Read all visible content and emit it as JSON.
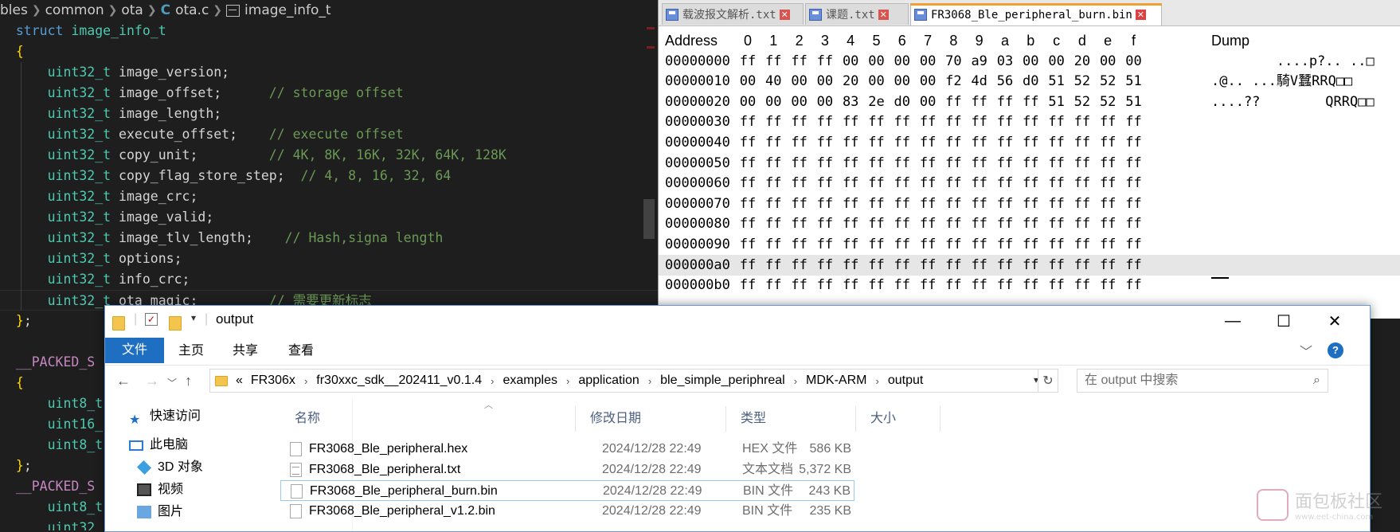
{
  "editor": {
    "breadcrumb": [
      "bles",
      "common",
      "ota",
      "ota.c",
      "image_info_t"
    ],
    "lines": [
      [
        [
          "kw",
          "struct "
        ],
        [
          "ty",
          "image_info_t"
        ]
      ],
      [
        [
          "br",
          "{"
        ]
      ],
      [
        [
          "id",
          "    "
        ],
        [
          "ty",
          "uint32_t"
        ],
        [
          "id",
          " image_version;"
        ]
      ],
      [
        [
          "id",
          "    "
        ],
        [
          "ty",
          "uint32_t"
        ],
        [
          "id",
          " image_offset;      "
        ],
        [
          "cm",
          "// storage offset"
        ]
      ],
      [
        [
          "id",
          "    "
        ],
        [
          "ty",
          "uint32_t"
        ],
        [
          "id",
          " image_length;"
        ]
      ],
      [
        [
          "id",
          "    "
        ],
        [
          "ty",
          "uint32_t"
        ],
        [
          "id",
          " execute_offset;    "
        ],
        [
          "cm",
          "// execute offset"
        ]
      ],
      [
        [
          "id",
          "    "
        ],
        [
          "ty",
          "uint32_t"
        ],
        [
          "id",
          " copy_unit;         "
        ],
        [
          "cm",
          "// 4K, 8K, 16K, 32K, 64K, 128K"
        ]
      ],
      [
        [
          "id",
          "    "
        ],
        [
          "ty",
          "uint32_t"
        ],
        [
          "id",
          " copy_flag_store_step;  "
        ],
        [
          "cm",
          "// 4, 8, 16, 32, 64"
        ]
      ],
      [
        [
          "id",
          "    "
        ],
        [
          "ty",
          "uint32_t"
        ],
        [
          "id",
          " image_crc;"
        ]
      ],
      [
        [
          "id",
          "    "
        ],
        [
          "ty",
          "uint32_t"
        ],
        [
          "id",
          " image_valid;"
        ]
      ],
      [
        [
          "id",
          "    "
        ],
        [
          "ty",
          "uint32_t"
        ],
        [
          "id",
          " image_tlv_length;    "
        ],
        [
          "cm",
          "// Hash,signa length"
        ]
      ],
      [
        [
          "id",
          "    "
        ],
        [
          "ty",
          "uint32_t"
        ],
        [
          "id",
          " options;"
        ]
      ],
      [
        [
          "id",
          "    "
        ],
        [
          "ty",
          "uint32_t"
        ],
        [
          "id",
          " info_crc;"
        ]
      ],
      [
        [
          "id",
          "    "
        ],
        [
          "ty",
          "uint32_t"
        ],
        [
          "id",
          " ota_magic;         "
        ],
        [
          "cm",
          "// 需要更新标志"
        ]
      ],
      [
        [
          "br",
          "}"
        ],
        [
          "id",
          ";"
        ]
      ],
      [
        [
          "id",
          ""
        ]
      ],
      [
        [
          "mc",
          "__PACKED_S"
        ]
      ],
      [
        [
          "br",
          "{"
        ]
      ],
      [
        [
          "id",
          "    "
        ],
        [
          "ty",
          "uint8_t"
        ]
      ],
      [
        [
          "id",
          "    "
        ],
        [
          "ty",
          "uint16_"
        ]
      ],
      [
        [
          "id",
          "    "
        ],
        [
          "ty",
          "uint8_t"
        ]
      ],
      [
        [
          "br",
          "}"
        ],
        [
          "id",
          ";"
        ]
      ],
      [
        [
          "mc",
          "__PACKED_S"
        ]
      ],
      [
        [
          "id",
          "    "
        ],
        [
          "ty",
          "uint8_t"
        ]
      ],
      [
        [
          "id",
          "    "
        ],
        [
          "ty",
          "uint32_"
        ]
      ]
    ]
  },
  "hex": {
    "tabs": [
      {
        "label": "载波报文解析.txt",
        "active": false
      },
      {
        "label": "课题.txt",
        "active": false
      },
      {
        "label": "FR3068_Ble_peripheral_burn.bin",
        "active": true
      }
    ],
    "header": {
      "address": "Address",
      "cols": [
        "0",
        "1",
        "2",
        "3",
        "4",
        "5",
        "6",
        "7",
        "8",
        "9",
        "a",
        "b",
        "c",
        "d",
        "e",
        "f"
      ],
      "dump": "Dump"
    },
    "rows": [
      {
        "addr": "00000000",
        "bytes": [
          "ff",
          "ff",
          "ff",
          "ff",
          "00",
          "00",
          "00",
          "00",
          "70",
          "a9",
          "03",
          "00",
          "00",
          "20",
          "00",
          "00"
        ],
        "dump": "        ....p?.. ..□"
      },
      {
        "addr": "00000010",
        "bytes": [
          "00",
          "40",
          "00",
          "00",
          "20",
          "00",
          "00",
          "00",
          "f2",
          "4d",
          "56",
          "d0",
          "51",
          "52",
          "52",
          "51"
        ],
        "dump": ".@.. ...騎V蠶RRQ□□"
      },
      {
        "addr": "00000020",
        "bytes": [
          "00",
          "00",
          "00",
          "00",
          "83",
          "2e",
          "d0",
          "00",
          "ff",
          "ff",
          "ff",
          "ff",
          "51",
          "52",
          "52",
          "51"
        ],
        "dump": "....??        QRRQ□□"
      },
      {
        "addr": "00000030",
        "bytes": [
          "ff",
          "ff",
          "ff",
          "ff",
          "ff",
          "ff",
          "ff",
          "ff",
          "ff",
          "ff",
          "ff",
          "ff",
          "ff",
          "ff",
          "ff",
          "ff"
        ],
        "dump": ""
      },
      {
        "addr": "00000040",
        "bytes": [
          "ff",
          "ff",
          "ff",
          "ff",
          "ff",
          "ff",
          "ff",
          "ff",
          "ff",
          "ff",
          "ff",
          "ff",
          "ff",
          "ff",
          "ff",
          "ff"
        ],
        "dump": ""
      },
      {
        "addr": "00000050",
        "bytes": [
          "ff",
          "ff",
          "ff",
          "ff",
          "ff",
          "ff",
          "ff",
          "ff",
          "ff",
          "ff",
          "ff",
          "ff",
          "ff",
          "ff",
          "ff",
          "ff"
        ],
        "dump": ""
      },
      {
        "addr": "00000060",
        "bytes": [
          "ff",
          "ff",
          "ff",
          "ff",
          "ff",
          "ff",
          "ff",
          "ff",
          "ff",
          "ff",
          "ff",
          "ff",
          "ff",
          "ff",
          "ff",
          "ff"
        ],
        "dump": ""
      },
      {
        "addr": "00000070",
        "bytes": [
          "ff",
          "ff",
          "ff",
          "ff",
          "ff",
          "ff",
          "ff",
          "ff",
          "ff",
          "ff",
          "ff",
          "ff",
          "ff",
          "ff",
          "ff",
          "ff"
        ],
        "dump": ""
      },
      {
        "addr": "00000080",
        "bytes": [
          "ff",
          "ff",
          "ff",
          "ff",
          "ff",
          "ff",
          "ff",
          "ff",
          "ff",
          "ff",
          "ff",
          "ff",
          "ff",
          "ff",
          "ff",
          "ff"
        ],
        "dump": ""
      },
      {
        "addr": "00000090",
        "bytes": [
          "ff",
          "ff",
          "ff",
          "ff",
          "ff",
          "ff",
          "ff",
          "ff",
          "ff",
          "ff",
          "ff",
          "ff",
          "ff",
          "ff",
          "ff",
          "ff"
        ],
        "dump": ""
      },
      {
        "addr": "000000a0",
        "bytes": [
          "ff",
          "ff",
          "ff",
          "ff",
          "ff",
          "ff",
          "ff",
          "ff",
          "ff",
          "ff",
          "ff",
          "ff",
          "ff",
          "ff",
          "ff",
          "ff"
        ],
        "dump": ""
      },
      {
        "addr": "000000b0",
        "bytes": [
          "ff",
          "ff",
          "ff",
          "ff",
          "ff",
          "ff",
          "ff",
          "ff",
          "ff",
          "ff",
          "ff",
          "ff",
          "ff",
          "ff",
          "ff",
          "ff"
        ],
        "dump": ""
      }
    ]
  },
  "explorer": {
    "title": "output",
    "window_buttons": {
      "minimize": "—",
      "maximize": "☐",
      "close": "✕"
    },
    "ribbon_tabs": [
      "文件",
      "主页",
      "共享",
      "查看"
    ],
    "help": "?",
    "path": [
      "FR306x",
      "fr30xxc_sdk__202411_v0.1.4",
      "examples",
      "application",
      "ble_simple_periphreal",
      "MDK-ARM",
      "output"
    ],
    "path_prefix": "«",
    "search_placeholder": "在 output 中搜索",
    "sidebar": [
      "快速访问",
      "此电脑",
      "3D 对象",
      "视频",
      "图片"
    ],
    "columns": [
      "名称",
      "修改日期",
      "类型",
      "大小"
    ],
    "files": [
      {
        "name": "FR3068_Ble_peripheral.hex",
        "date": "2024/12/28 22:49",
        "type": "HEX 文件",
        "size": "586 KB",
        "selected": false,
        "icon": "file-icon"
      },
      {
        "name": "FR3068_Ble_peripheral.txt",
        "date": "2024/12/28 22:49",
        "type": "文本文档",
        "size": "5,372 KB",
        "selected": false,
        "icon": "text-file-icon"
      },
      {
        "name": "FR3068_Ble_peripheral_burn.bin",
        "date": "2024/12/28 22:49",
        "type": "BIN 文件",
        "size": "243 KB",
        "selected": true,
        "icon": "file-icon"
      },
      {
        "name": "FR3068_Ble_peripheral_v1.2.bin",
        "date": "2024/12/28 22:49",
        "type": "BIN 文件",
        "size": "235 KB",
        "selected": false,
        "icon": "file-icon"
      }
    ]
  },
  "watermark": {
    "title": "面包板社区",
    "sub": "www.eet-china.com"
  }
}
